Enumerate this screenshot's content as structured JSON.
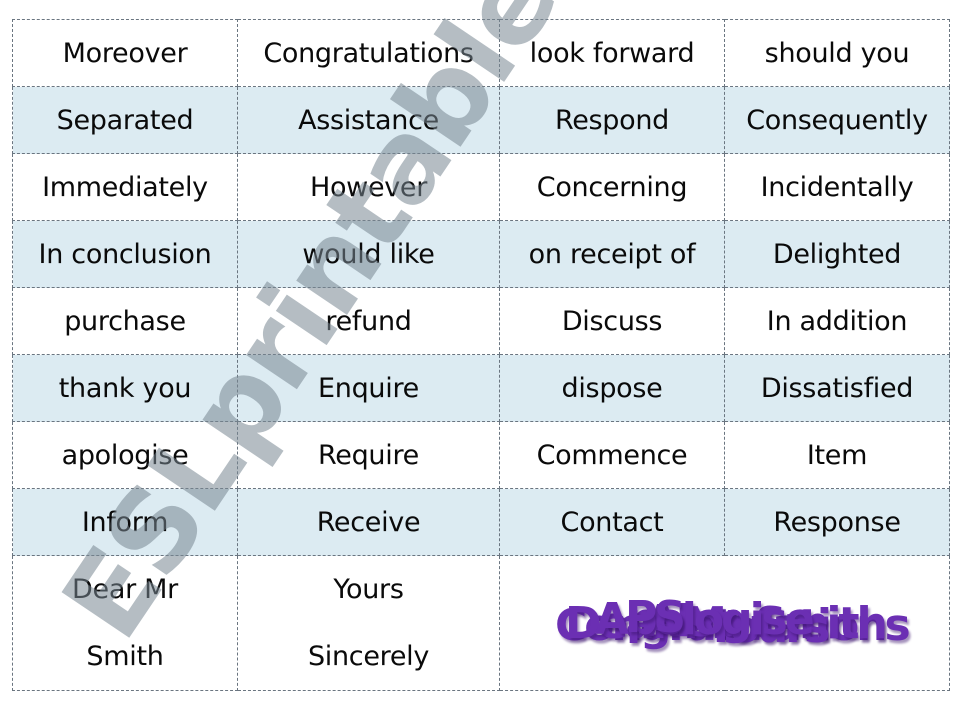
{
  "worksheet": {
    "rows": [
      {
        "shaded": false,
        "cells": [
          "Moreover",
          "Congratulations",
          "look forward",
          "should you"
        ]
      },
      {
        "shaded": true,
        "cells": [
          "Separated",
          "Assistance",
          "Respond",
          "Consequently"
        ]
      },
      {
        "shaded": false,
        "cells": [
          "Immediately",
          "However",
          "Concerning",
          "Incidentally"
        ]
      },
      {
        "shaded": true,
        "cells": [
          "In conclusion",
          "would like",
          "on receipt of",
          "Delighted"
        ]
      },
      {
        "shaded": false,
        "cells": [
          "purchase",
          "refund",
          "Discuss",
          "In addition"
        ]
      },
      {
        "shaded": true,
        "cells": [
          "thank you",
          "Enquire",
          "dispose",
          "Dissatisfied"
        ]
      },
      {
        "shaded": false,
        "cells": [
          "apologise",
          "Require",
          "Commence",
          "Item"
        ]
      },
      {
        "shaded": true,
        "cells": [
          "Inform",
          "Receive",
          "Contact",
          "Response"
        ]
      }
    ],
    "last_row": {
      "cell1_lines": [
        "Dear Mr",
        "Smith"
      ],
      "cell2_lines": [
        "Yours",
        "Sincerely"
      ]
    },
    "overlapping_title_words": [
      "Congratulations",
      "Dear Mr Smith",
      "Also",
      "Yours",
      "Apologise",
      "PS"
    ],
    "colors": {
      "shaded_row": "#dcebf2",
      "border": "#6a7580",
      "title_purple": "#6b2fb3"
    }
  },
  "watermark": {
    "text": "ESLprintables.com"
  }
}
